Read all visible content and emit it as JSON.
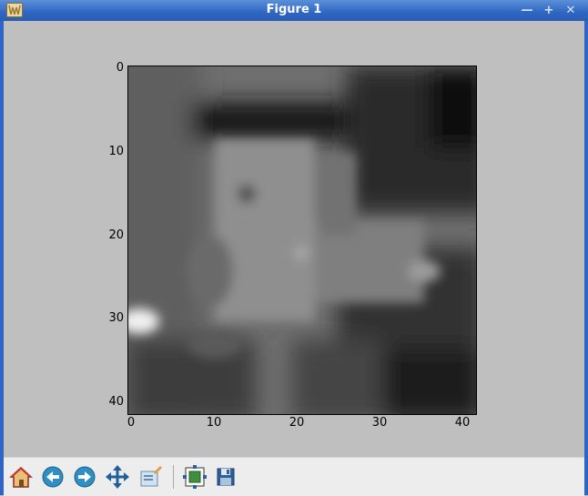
{
  "window": {
    "title": "Figure 1"
  },
  "plot": {
    "y_ticks": [
      "0",
      "10",
      "20",
      "30",
      "40"
    ],
    "x_ticks": [
      "0",
      "10",
      "20",
      "30",
      "40"
    ]
  },
  "toolbar": {
    "buttons": [
      "home",
      "back",
      "forward",
      "pan",
      "zoom",
      "subplots",
      "save"
    ]
  },
  "chart_data": {
    "type": "heatmap",
    "xlim": [
      0,
      41
    ],
    "ylim": [
      41,
      0
    ],
    "colormap": "gray"
  }
}
